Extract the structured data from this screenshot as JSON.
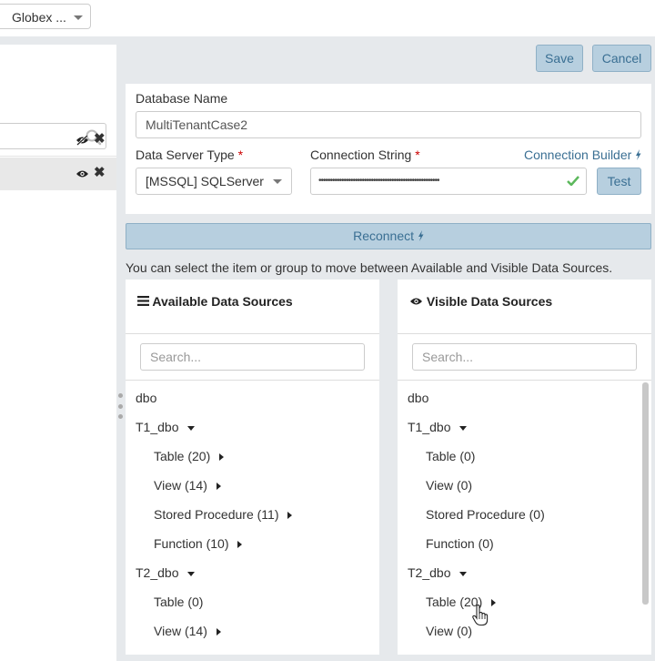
{
  "tenant": {
    "label": "Globex ..."
  },
  "toolbar": {
    "save_label": "Save",
    "cancel_label": "Cancel"
  },
  "form": {
    "db_name_label": "Database Name",
    "db_name_value": "MultiTenantCase2",
    "server_type_label": "Data Server Type",
    "server_type_value": "[MSSQL] SQLServer",
    "conn_label": "Connection String",
    "conn_value": "•••••••••••••••••••••••••••••••••••••••••••••••••••••",
    "conn_builder_label": "Connection Builder",
    "test_label": "Test",
    "required_mark": "*"
  },
  "reconnect_label": "Reconnect",
  "hint": "You can select the item or group to move between Available and Visible Data Sources.",
  "available": {
    "title": "Available Data Sources",
    "search_placeholder": "Search...",
    "items": [
      "dbo",
      "T1_dbo",
      "Table (20)",
      "View (14)",
      "Stored Procedure (11)",
      "Function (10)",
      "T2_dbo",
      "Table (0)",
      "View (14)"
    ]
  },
  "visible": {
    "title": "Visible Data Sources",
    "search_placeholder": "Search...",
    "items": [
      "dbo",
      "T1_dbo",
      "Table (0)",
      "View (0)",
      "Stored Procedure (0)",
      "Function (0)",
      "T2_dbo",
      "Table (20)",
      "View (0)"
    ]
  },
  "icons": {
    "search": "search-icon",
    "eye": "eye-icon",
    "eye_slash": "eye-slash-icon",
    "close": "close-icon",
    "check": "check-icon",
    "bolt": "bolt-icon",
    "list": "list-icon",
    "pointer": "hand-pointer-icon"
  },
  "colors": {
    "accent": "#3a6f93",
    "button_bg": "#b7cfdf",
    "required": "#cc0000",
    "check": "#5cb85c"
  }
}
